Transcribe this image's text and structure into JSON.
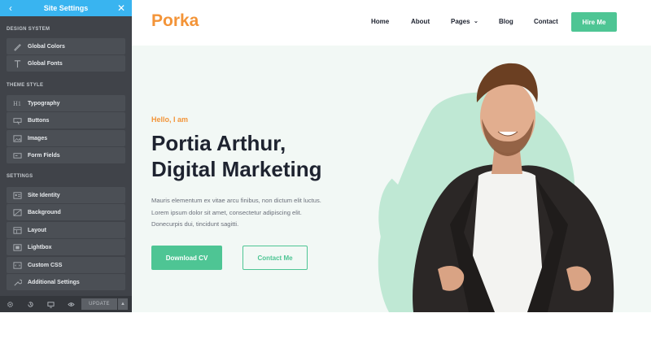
{
  "sidebar": {
    "title": "Site Settings",
    "sections": {
      "design_system": "DESIGN SYSTEM",
      "theme_style": "THEME STYLE",
      "settings": "SETTINGS"
    },
    "items": [
      {
        "label": "Global Colors",
        "icon": "brush-icon"
      },
      {
        "label": "Global Fonts",
        "icon": "font-icon"
      },
      {
        "label": "Typography",
        "icon": "heading-icon"
      },
      {
        "label": "Buttons",
        "icon": "button-icon"
      },
      {
        "label": "Images",
        "icon": "image-icon"
      },
      {
        "label": "Form Fields",
        "icon": "form-icon"
      },
      {
        "label": "Site Identity",
        "icon": "id-card-icon"
      },
      {
        "label": "Background",
        "icon": "background-icon"
      },
      {
        "label": "Layout",
        "icon": "layout-icon"
      },
      {
        "label": "Lightbox",
        "icon": "lightbox-icon"
      },
      {
        "label": "Custom CSS",
        "icon": "code-icon"
      },
      {
        "label": "Additional Settings",
        "icon": "wrench-icon"
      }
    ],
    "footer": {
      "update_label": "UPDATE"
    }
  },
  "site": {
    "logo": "Porka",
    "menu": [
      "Home",
      "About",
      "Pages",
      "Blog",
      "Contact"
    ],
    "hire_label": "Hire Me",
    "hero": {
      "greeting": "Hello, I am",
      "name_line1": "Portia Arthur,",
      "name_line2": "Digital Marketing",
      "desc_line1": "Mauris elementum ex vitae arcu finibus, non dictum elit luctus.",
      "desc_line2": "Lorem ipsum dolor sit amet, consectetur adipiscing elit.",
      "desc_line3": "Donecurpis dui, tincidunt sagitti.",
      "download_label": "Download CV",
      "contact_label": "Contact Me"
    }
  },
  "colors": {
    "accent_green": "#4ec594",
    "accent_orange": "#f39438",
    "sidebar_bg": "#404349",
    "header_blue": "#39b4f0"
  }
}
